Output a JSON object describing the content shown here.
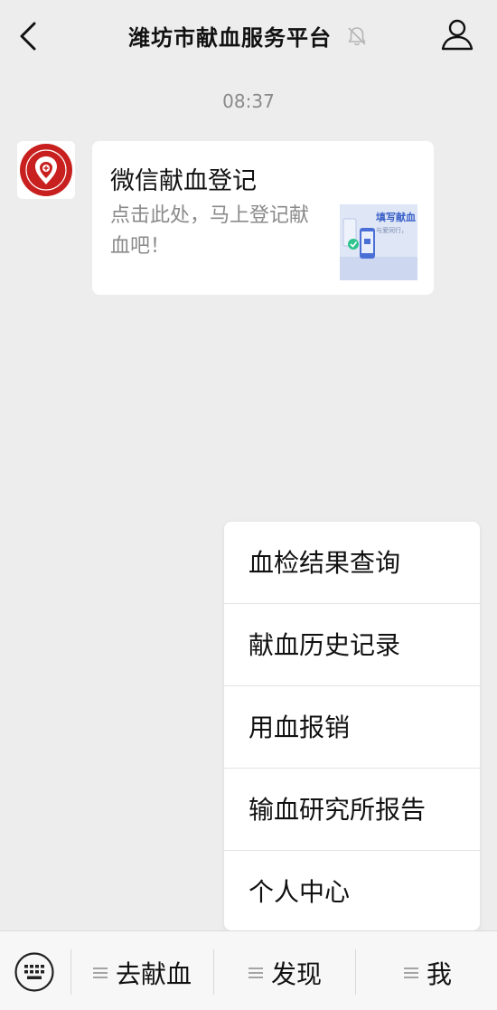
{
  "header": {
    "title": "潍坊市献血服务平台",
    "back_icon": "chevron-left-icon",
    "mute_icon": "bell-muted-icon",
    "profile_icon": "person-icon"
  },
  "chat": {
    "timestamp": "08:37",
    "message": {
      "avatar_icon": "blood-center-logo",
      "title": "微信献血登记",
      "description": "点击此处，马上登记献血吧！",
      "thumbnail": {
        "title": "填写献血",
        "subtitle": "与爱同行，"
      }
    }
  },
  "menu": {
    "items": [
      {
        "label": "血检结果查询"
      },
      {
        "label": "献血历史记录"
      },
      {
        "label": "用血报销"
      },
      {
        "label": "输血研究所报告"
      },
      {
        "label": "个人中心"
      }
    ]
  },
  "bottom_bar": {
    "keyboard_icon": "keyboard-icon",
    "tabs": [
      {
        "label": "去献血",
        "icon": "menu-lines-icon"
      },
      {
        "label": "发现",
        "icon": "menu-lines-icon"
      },
      {
        "label": "我",
        "icon": "menu-lines-icon"
      }
    ]
  },
  "colors": {
    "background": "#ededed",
    "card": "#ffffff",
    "logo_red": "#c8201e",
    "muted_text": "#8a8a8a"
  }
}
